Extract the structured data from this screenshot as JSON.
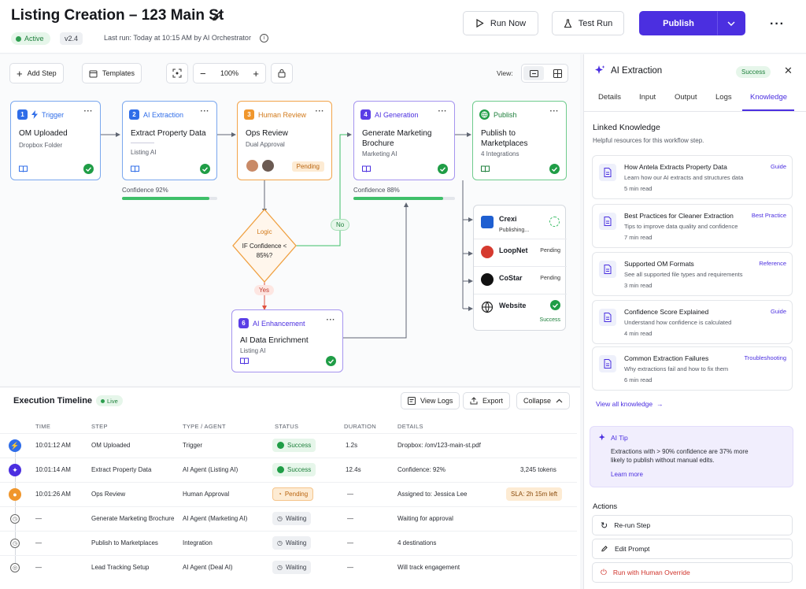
{
  "header": {
    "title": "Listing Creation – 123 Main St",
    "status": "Active",
    "version": "v2.4",
    "last_run": "Last run: Today at 10:15 AM by AI Orchestrator",
    "run_now": "Run Now",
    "test_run": "Test Run",
    "publish": "Publish"
  },
  "toolbar": {
    "add_step": "Add Step",
    "templates": "Templates",
    "zoom": "100%",
    "view_label": "View:"
  },
  "nodes": {
    "trigger": {
      "num": "1",
      "type": "Trigger",
      "title": "OM Uploaded",
      "sub": "Dropbox Folder"
    },
    "extraction": {
      "num": "2",
      "type": "AI Extraction",
      "title": "Extract Property Data",
      "sub": "Listing AI",
      "confidence": "Confidence 92%",
      "confidence_value": 0.92
    },
    "review": {
      "num": "3",
      "type": "Human Review",
      "title": "Ops Review",
      "sub": "Dual Approval",
      "status": "Pending"
    },
    "generation": {
      "num": "4",
      "type": "AI Generation",
      "title": "Generate Marketing Brochure",
      "sub": "Marketing AI",
      "confidence": "Confidence 88%",
      "confidence_value": 0.88
    },
    "publish": {
      "type": "Publish",
      "title": "Publish to Marketplaces",
      "sub": "4 Integrations"
    },
    "enhancement": {
      "num": "6",
      "type": "AI Enhancement",
      "title": "AI Data Enrichment",
      "sub": "Listing AI"
    },
    "logic": {
      "label": "Logic",
      "condition": "IF Confidence < 85%?",
      "yes": "Yes",
      "no": "No"
    }
  },
  "marketplaces": [
    {
      "name": "Crexi",
      "status": "Publishing..."
    },
    {
      "name": "LoopNet",
      "status": "Pending"
    },
    {
      "name": "CoStar",
      "status": "Pending"
    },
    {
      "name": "Website",
      "status": "Success"
    }
  ],
  "timeline": {
    "title": "Execution Timeline",
    "live": "Live",
    "view_logs": "View Logs",
    "export": "Export",
    "collapse": "Collapse",
    "columns": [
      "TIME",
      "STEP",
      "TYPE / AGENT",
      "STATUS",
      "DURATION",
      "DETAILS"
    ],
    "rows": [
      {
        "time": "10:01:12 AM",
        "step": "OM Uploaded",
        "type": "Trigger",
        "status": "Success",
        "duration": "1.2s",
        "details": "Dropbox: /om/123-main-st.pdf",
        "extra": ""
      },
      {
        "time": "10:01:14 AM",
        "step": "Extract Property Data",
        "type": "AI Agent (Listing AI)",
        "status": "Success",
        "duration": "12.4s",
        "details": "Confidence: 92%",
        "extra": "3,245 tokens"
      },
      {
        "time": "10:01:26 AM",
        "step": "Ops Review",
        "type": "Human Approval",
        "status": "Pending",
        "duration": "—",
        "details": "Assigned to: Jessica Lee",
        "extra": "SLA: 2h 15m left"
      },
      {
        "time": "—",
        "step": "Generate Marketing Brochure",
        "type": "AI Agent (Marketing AI)",
        "status": "Waiting",
        "duration": "—",
        "details": "Waiting for approval",
        "extra": ""
      },
      {
        "time": "—",
        "step": "Publish to Marketplaces",
        "type": "Integration",
        "status": "Waiting",
        "duration": "—",
        "details": "4 destinations",
        "extra": ""
      },
      {
        "time": "—",
        "step": "Lead Tracking Setup",
        "type": "AI Agent (Deal AI)",
        "status": "Waiting",
        "duration": "—",
        "details": "Will track engagement",
        "extra": ""
      }
    ]
  },
  "panel": {
    "title": "AI Extraction",
    "status": "Success",
    "tabs": [
      "Details",
      "Input",
      "Output",
      "Logs",
      "Knowledge"
    ],
    "linked_title": "Linked Knowledge",
    "linked_sub": "Helpful resources for this workflow step.",
    "knowledge": [
      {
        "title": "How Antela Extracts Property Data",
        "desc": "Learn how our AI extracts and structures data",
        "time": "5 min read",
        "tag": "Guide"
      },
      {
        "title": "Best Practices for Cleaner Extraction",
        "desc": "Tips to improve data quality and confidence",
        "time": "7 min read",
        "tag": "Best Practice"
      },
      {
        "title": "Supported OM Formats",
        "desc": "See all supported file types and requirements",
        "time": "3 min read",
        "tag": "Reference"
      },
      {
        "title": "Confidence Score Explained",
        "desc": "Understand how confidence is calculated",
        "time": "4 min read",
        "tag": "Guide"
      },
      {
        "title": "Common Extraction Failures",
        "desc": "Why extractions fail and how to fix them",
        "time": "6 min read",
        "tag": "Troubleshooting"
      }
    ],
    "view_all": "View all knowledge",
    "tip_title": "AI Tip",
    "tip_text": "Extractions with > 90% confidence are 37% more likely to publish without manual edits.",
    "tip_link": "Learn more",
    "actions_title": "Actions",
    "actions": [
      "Re-run Step",
      "Edit Prompt",
      "Run with Human Override"
    ]
  }
}
